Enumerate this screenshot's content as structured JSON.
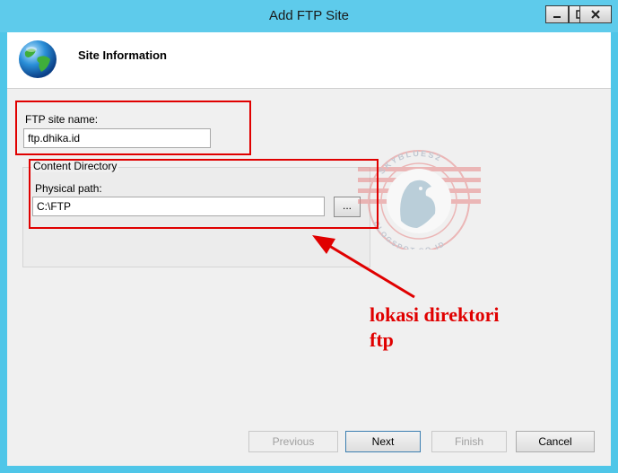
{
  "window": {
    "title": "Add FTP Site",
    "minimize_icon": "minimize-icon",
    "maximize_icon": "maximize-icon",
    "close_icon": "close-icon"
  },
  "header": {
    "icon": "globe-icon",
    "title": "Site Information"
  },
  "form": {
    "site_name_label": "FTP site name:",
    "site_name_value": "ftp.dhika.id",
    "content_directory_label": "Content Directory",
    "physical_path_label": "Physical path:",
    "physical_path_value": "C:\\FTP",
    "browse_label": "..."
  },
  "buttons": {
    "previous": "Previous",
    "next": "Next",
    "finish": "Finish",
    "cancel": "Cancel"
  },
  "annotation": {
    "line1": "lokasi direktori",
    "line2": "ftp",
    "color": "#e00000"
  },
  "watermark": {
    "top_text": "SKYBLUES2",
    "bottom_text": "BLOGSPOT.CO.ID"
  },
  "colors": {
    "titlebar": "#5ecbeb",
    "frame": "#4fc6e8",
    "accent_red": "#e00000"
  }
}
